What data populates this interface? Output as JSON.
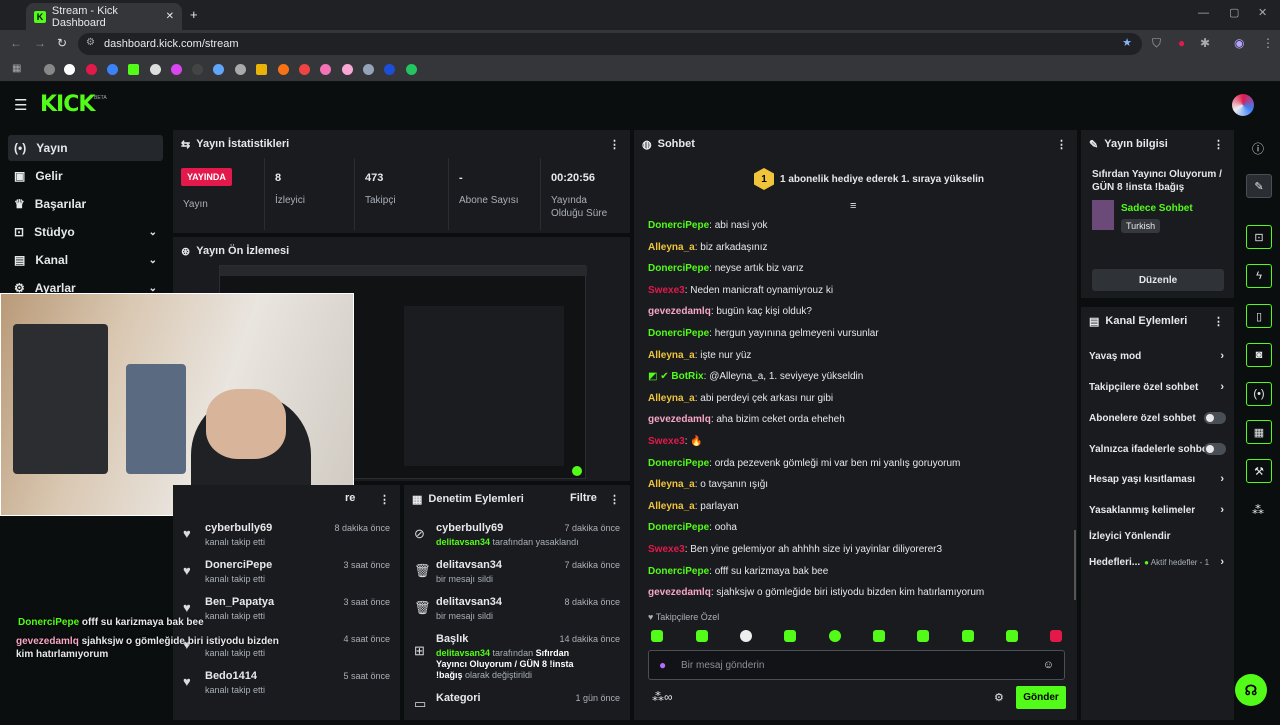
{
  "browser": {
    "tab_title": "Stream - Kick Dashboard",
    "url": "dashboard.kick.com/stream"
  },
  "app": {
    "logo": "KICK",
    "logo_badge": "BETA"
  },
  "sidebar": {
    "items": [
      {
        "label": "Yayın",
        "icon": "broadcast-icon"
      },
      {
        "label": "Gelir",
        "icon": "wallet-icon"
      },
      {
        "label": "Başarılar",
        "icon": "trophy-icon"
      },
      {
        "label": "Stüdyo",
        "icon": "studio-icon"
      },
      {
        "label": "Kanal",
        "icon": "channel-icon"
      },
      {
        "label": "Ayarlar",
        "icon": "gear-icon"
      }
    ]
  },
  "stats": {
    "title": "Yayın İstatistikleri",
    "live_badge": "YAYINDA",
    "live_label": "Yayın",
    "viewers": {
      "value": "8",
      "label": "İzleyici"
    },
    "followers": {
      "value": "473",
      "label": "Takipçi"
    },
    "subs": {
      "value": "-",
      "label": "Abone Sayısı"
    },
    "duration": {
      "value": "00:20:56",
      "label1": "Yayında",
      "label2": "Olduğu Süre"
    }
  },
  "preview": {
    "title": "Yayın Ön İzlemesi"
  },
  "activity": {
    "title": "re",
    "items": [
      {
        "name": "cyberbully69",
        "sub": "kanalı takip etti",
        "time": "8 dakika önce"
      },
      {
        "name": "DonerciPepe",
        "sub": "kanalı takip etti",
        "time": "3 saat önce"
      },
      {
        "name": "Ben_Papatya",
        "sub": "kanalı takip etti",
        "time": "3 saat önce"
      },
      {
        "name": "",
        "sub": "kanalı takip etti",
        "time": "4 saat önce"
      },
      {
        "name": "Bedo1414",
        "sub": "kanalı takip etti",
        "time": "5 saat önce"
      }
    ]
  },
  "moderation": {
    "title": "Denetim Eylemleri",
    "filter": "Filtre",
    "items": [
      {
        "name": "cyberbully69",
        "actor": "delitavsan34",
        "rest": "tarafından yasaklandı",
        "time": "7 dakika önce"
      },
      {
        "name": "delitavsan34",
        "sub": "bir mesajı sildi",
        "time": "7 dakika önce"
      },
      {
        "name": "delitavsan34",
        "sub": "bir mesajı sildi",
        "time": "8 dakika önce"
      },
      {
        "name": "Başlık",
        "actor": "delitavsan34",
        "rest": "tarafından",
        "title_change": "Sıfırdan Yayıncı Oluyorum / GÜN 8 !insta !bağış",
        "suffix": "olarak değiştirildi",
        "time": "14 dakika önce"
      },
      {
        "name": "Kategori",
        "time": "1 gün önce"
      }
    ]
  },
  "chat": {
    "title": "Sohbet",
    "pinned": "1 abonelik hediye ederek 1. sıraya yükselin",
    "pinned_rank": "1",
    "messages": [
      {
        "user": "DonerciPepe",
        "color": "#53fc18",
        "text": "abi nasi yok"
      },
      {
        "user": "Alleyna_a",
        "color": "#f0c53b",
        "text": "biz arkadaşınız"
      },
      {
        "user": "DonerciPepe",
        "color": "#53fc18",
        "text": "neyse artık biz varız"
      },
      {
        "user": "Swexe3",
        "color": "#e3194b",
        "text": "Neden manicraft oynamiyrouz ki"
      },
      {
        "user": "gevezedamlq",
        "color": "#f7a7c3",
        "text": "bugün kaç kişi olduk?"
      },
      {
        "user": "DonerciPepe",
        "color": "#53fc18",
        "text": "hergun yayınına gelmeyeni vursunlar"
      },
      {
        "user": "Alleyna_a",
        "color": "#f0c53b",
        "text": "işte nur yüz"
      },
      {
        "user": "BotRix",
        "color": "#53fc18",
        "text": "@Alleyna_a, 1. seviyeye yükseldin"
      },
      {
        "user": "Alleyna_a",
        "color": "#f0c53b",
        "text": "abi perdeyi çek arkası nur gibi"
      },
      {
        "user": "gevezedamlq",
        "color": "#f7a7c3",
        "text": "aha bizim ceket orda eheheh"
      },
      {
        "user": "Swexe3",
        "color": "#e3194b",
        "text": ""
      },
      {
        "user": "DonerciPepe",
        "color": "#53fc18",
        "text": "orda pezevenk gömleği mi var ben mi yanlış goruyorum"
      },
      {
        "user": "Alleyna_a",
        "color": "#f0c53b",
        "text": "o tavşanın ışığı"
      },
      {
        "user": "Alleyna_a",
        "color": "#f0c53b",
        "text": "parlayan"
      },
      {
        "user": "DonerciPepe",
        "color": "#53fc18",
        "text": "ooha"
      },
      {
        "user": "Swexe3",
        "color": "#e3194b",
        "text": "Ben yine gelemiyor ah ahhhh size iyi yayinlar diliyorerer3"
      },
      {
        "user": "DonerciPepe",
        "color": "#53fc18",
        "text": "offf su karizmaya bak bee"
      },
      {
        "user": "gevezedamlq",
        "color": "#f7a7c3",
        "text": "sjahksjw o gömleğide biri istiyodu bizden kim hatırlamıyorum"
      }
    ],
    "followers_only": "Takipçilere Özel",
    "input_placeholder": "Bir mesaj gönderin",
    "send": "Gönder"
  },
  "overlay_chat": [
    {
      "user": "DonerciPepe",
      "color": "#53fc18",
      "text": "offf su karizmaya bak bee"
    },
    {
      "user": "gevezedamlq",
      "color": "#f7a7c3",
      "text": "sjahksjw o gömleğide biri istiyodu bizden kim hatırlamıyorum"
    }
  ],
  "stream_info": {
    "title": "Yayın bilgisi",
    "stream_title": "Sıfırdan Yayıncı Oluyorum / GÜN 8 !insta !bağış",
    "category": "Sadece Sohbet",
    "language": "Turkish",
    "edit": "Düzenle"
  },
  "channel_actions": {
    "title": "Kanal Eylemleri",
    "items": [
      {
        "label": "Yavaş mod",
        "type": "chevron"
      },
      {
        "label": "Takipçilere özel sohbet",
        "type": "chevron"
      },
      {
        "label": "Abonelere özel sohbet",
        "type": "toggle"
      },
      {
        "label": "Yalnızca ifadelerle sohbet",
        "type": "toggle"
      },
      {
        "label": "Hesap yaşı kısıtlaması",
        "type": "chevron"
      },
      {
        "label": "Yasaklanmış kelimeler",
        "type": "chevron"
      },
      {
        "label": "İzleyici Yönlendir",
        "type": "none"
      }
    ],
    "goals_label": "Hedefleri...",
    "goals_status": "Aktif hedefler - 1"
  },
  "colors": {
    "accent": "#53fc18",
    "panel": "#191b1f",
    "bg": "#0b0e0f",
    "live": "#e3194b"
  }
}
